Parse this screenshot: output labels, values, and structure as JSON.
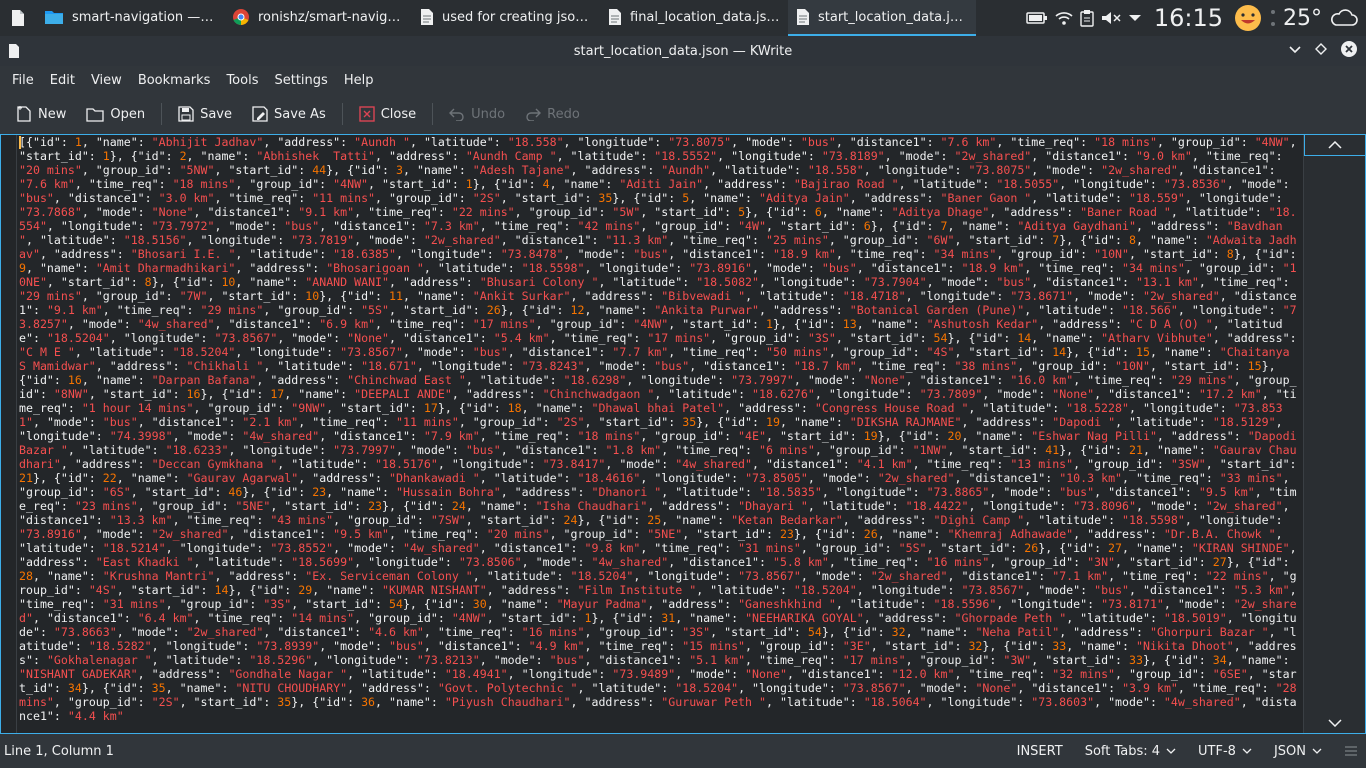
{
  "taskbar": {
    "tasks": [
      {
        "label": "smart-navigation — Do...",
        "icon": "folder-icon",
        "active": false
      },
      {
        "label": "ronishz/smart-navigati...",
        "icon": "chrome-icon",
        "active": false
      },
      {
        "label": "used for creating json ...",
        "icon": "document-icon",
        "active": false
      },
      {
        "label": "final_location_data.jso...",
        "icon": "document-icon",
        "active": false
      },
      {
        "label": "start_location_data.jso...",
        "icon": "document-icon",
        "active": true
      }
    ],
    "clock": "16:15",
    "temperature": "25°"
  },
  "window": {
    "title": "start_location_data.json — KWrite"
  },
  "menu": [
    "File",
    "Edit",
    "View",
    "Bookmarks",
    "Tools",
    "Settings",
    "Help"
  ],
  "toolbar": {
    "new": "New",
    "open": "Open",
    "save": "Save",
    "save_as": "Save As",
    "close": "Close",
    "undo": "Undo",
    "redo": "Redo"
  },
  "editor": {
    "content": "[{\"id\": 1, \"name\": \"Abhijit Jadhav\", \"address\": \"Aundh \", \"latitude\": \"18.558\", \"longitude\": \"73.8075\", \"mode\": \"bus\", \"distance1\": \"7.6 km\", \"time_req\": \"18 mins\", \"group_id\": \"4NW\", \"start_id\": 1}, {\"id\": 2, \"name\": \"Abhishek  Tatti\", \"address\": \"Aundh Camp \", \"latitude\": \"18.5552\", \"longitude\": \"73.8189\", \"mode\": \"2w_shared\", \"distance1\": \"9.0 km\", \"time_req\": \"20 mins\", \"group_id\": \"5NW\", \"start_id\": 44}, {\"id\": 3, \"name\": \"Adesh Tajane\", \"address\": \"Aundh\", \"latitude\": \"18.558\", \"longitude\": \"73.8075\", \"mode\": \"2w_shared\", \"distance1\": \"7.6 km\", \"time_req\": \"18 mins\", \"group_id\": \"4NW\", \"start_id\": 1}, {\"id\": 4, \"name\": \"Aditi Jain\", \"address\": \"Bajirao Road \", \"latitude\": \"18.5055\", \"longitude\": \"73.8536\", \"mode\": \"bus\", \"distance1\": \"3.0 km\", \"time_req\": \"11 mins\", \"group_id\": \"2S\", \"start_id\": 35}, {\"id\": 5, \"name\": \"Aditya Jain\", \"address\": \"Baner Gaon \", \"latitude\": \"18.559\", \"longitude\": \"73.7868\", \"mode\": \"None\", \"distance1\": \"9.1 km\", \"time_req\": \"22 mins\", \"group_id\": \"5W\", \"start_id\": 5}, {\"id\": 6, \"name\": \"Aditya Dhage\", \"address\": \"Baner Road \", \"latitude\": \"18.554\", \"longitude\": \"73.7972\", \"mode\": \"bus\", \"distance1\": \"7.3 km\", \"time_req\": \"42 mins\", \"group_id\": \"4W\", \"start_id\": 6}, {\"id\": 7, \"name\": \"Aditya Gaydhani\", \"address\": \"Bavdhan \", \"latitude\": \"18.5156\", \"longitude\": \"73.7819\", \"mode\": \"2w_shared\", \"distance1\": \"11.3 km\", \"time_req\": \"25 mins\", \"group_id\": \"6W\", \"start_id\": 7}, {\"id\": 8, \"name\": \"Adwaita Jadhav\", \"address\": \"Bhosari I.E. \", \"latitude\": \"18.6385\", \"longitude\": \"73.8478\", \"mode\": \"bus\", \"distance1\": \"18.9 km\", \"time_req\": \"34 mins\", \"group_id\": \"10N\", \"start_id\": 8}, {\"id\": 9, \"name\": \"Amit Dharmadhikari\", \"address\": \"Bhosarigoan \", \"latitude\": \"18.5598\", \"longitude\": \"73.8916\", \"mode\": \"bus\", \"distance1\": \"18.9 km\", \"time_req\": \"34 mins\", \"group_id\": \"10NE\", \"start_id\": 8}, {\"id\": 10, \"name\": \"ANAND WANI\", \"address\": \"Bhusari Colony \", \"latitude\": \"18.5082\", \"longitude\": \"73.7904\", \"mode\": \"bus\", \"distance1\": \"13.1 km\", \"time_req\": \"29 mins\", \"group_id\": \"7W\", \"start_id\": 10}, {\"id\": 11, \"name\": \"Ankit Surkar\", \"address\": \"Bibvewadi \", \"latitude\": \"18.4718\", \"longitude\": \"73.8671\", \"mode\": \"2w_shared\", \"distance1\": \"9.1 km\", \"time_req\": \"29 mins\", \"group_id\": \"5S\", \"start_id\": 26}, {\"id\": 12, \"name\": \"Ankita Purwar\", \"address\": \"Botanical Garden (Pune)\", \"latitude\": \"18.566\", \"longitude\": \"73.8257\", \"mode\": \"4w_shared\", \"distance1\": \"6.9 km\", \"time_req\": \"17 mins\", \"group_id\": \"4NW\", \"start_id\": 1}, {\"id\": 13, \"name\": \"Ashutosh Kedar\", \"address\": \"C D A (O) \", \"latitude\": \"18.5204\", \"longitude\": \"73.8567\", \"mode\": \"None\", \"distance1\": \"5.4 km\", \"time_req\": \"17 mins\", \"group_id\": \"3S\", \"start_id\": 54}, {\"id\": 14, \"name\": \"Atharv Vibhute\", \"address\": \"C M E \", \"latitude\": \"18.5204\", \"longitude\": \"73.8567\", \"mode\": \"bus\", \"distance1\": \"7.7 km\", \"time_req\": \"50 mins\", \"group_id\": \"4S\", \"start_id\": 14}, {\"id\": 15, \"name\": \"Chaitanya S Mamidwar\", \"address\": \"Chikhali \", \"latitude\": \"18.671\", \"longitude\": \"73.8243\", \"mode\": \"bus\", \"distance1\": \"18.7 km\", \"time_req\": \"38 mins\", \"group_id\": \"10N\", \"start_id\": 15}, {\"id\": 16, \"name\": \"Darpan Bafana\", \"address\": \"Chinchwad East \", \"latitude\": \"18.6298\", \"longitude\": \"73.7997\", \"mode\": \"None\", \"distance1\": \"16.0 km\", \"time_req\": \"29 mins\", \"group_id\": \"8NW\", \"start_id\": 16}, {\"id\": 17, \"name\": \"DEEPALI ANDE\", \"address\": \"Chinchwadgaon \", \"latitude\": \"18.6276\", \"longitude\": \"73.7809\", \"mode\": \"None\", \"distance1\": \"17.2 km\", \"time_req\": \"1 hour 14 mins\", \"group_id\": \"9NW\", \"start_id\": 17}, {\"id\": 18, \"name\": \"Dhawal bhai Patel\", \"address\": \"Congress House Road \", \"latitude\": \"18.5228\", \"longitude\": \"73.8531\", \"mode\": \"bus\", \"distance1\": \"2.1 km\", \"time_req\": \"11 mins\", \"group_id\": \"2S\", \"start_id\": 35}, {\"id\": 19, \"name\": \"DIKSHA RAJMANE\", \"address\": \"Dapodi \", \"latitude\": \"18.5129\", \"longitude\": \"74.3998\", \"mode\": \"4w_shared\", \"distance1\": \"7.9 km\", \"time_req\": \"18 mins\", \"group_id\": \"4E\", \"start_id\": 19}, {\"id\": 20, \"name\": \"Eshwar Nag Pilli\", \"address\": \"Dapodi Bazar \", \"latitude\": \"18.6233\", \"longitude\": \"73.7997\", \"mode\": \"bus\", \"distance1\": \"1.8 km\", \"time_req\": \"6 mins\", \"group_id\": \"1NW\", \"start_id\": 41}, {\"id\": 21, \"name\": \"Gaurav Chaudhari\", \"address\": \"Deccan Gymkhana \", \"latitude\": \"18.5176\", \"longitude\": \"73.8417\", \"mode\": \"4w_shared\", \"distance1\": \"4.1 km\", \"time_req\": \"13 mins\", \"group_id\": \"3SW\", \"start_id\": 21}, {\"id\": 22, \"name\": \"Gaurav Agarwal\", \"address\": \"Dhankawadi \", \"latitude\": \"18.4616\", \"longitude\": \"73.8505\", \"mode\": \"2w_shared\", \"distance1\": \"10.3 km\", \"time_req\": \"33 mins\", \"group_id\": \"6S\", \"start_id\": 46}, {\"id\": 23, \"name\": \"Hussain Bohra\", \"address\": \"Dhanori \", \"latitude\": \"18.5835\", \"longitude\": \"73.8865\", \"mode\": \"bus\", \"distance1\": \"9.5 km\", \"time_req\": \"23 mins\", \"group_id\": \"5NE\", \"start_id\": 23}, {\"id\": 24, \"name\": \"Isha Chaudhari\", \"address\": \"Dhayari \", \"latitude\": \"18.4422\", \"longitude\": \"73.8096\", \"mode\": \"2w_shared\", \"distance1\": \"13.3 km\", \"time_req\": \"43 mins\", \"group_id\": \"7SW\", \"start_id\": 24}, {\"id\": 25, \"name\": \"Ketan Bedarkar\", \"address\": \"Dighi Camp \", \"latitude\": \"18.5598\", \"longitude\": \"73.8916\", \"mode\": \"2w_shared\", \"distance1\": \"9.5 km\", \"time_req\": \"20 mins\", \"group_id\": \"5NE\", \"start_id\": 23}, {\"id\": 26, \"name\": \"Khemraj Adhawade\", \"address\": \"Dr.B.A. Chowk \", \"latitude\": \"18.5214\", \"longitude\": \"73.8552\", \"mode\": \"4w_shared\", \"distance1\": \"9.8 km\", \"time_req\": \"31 mins\", \"group_id\": \"5S\", \"start_id\": 26}, {\"id\": 27, \"name\": \"KIRAN SHINDE\", \"address\": \"East Khadki \", \"latitude\": \"18.5699\", \"longitude\": \"73.8506\", \"mode\": \"4w_shared\", \"distance1\": \"5.8 km\", \"time_req\": \"16 mins\", \"group_id\": \"3N\", \"start_id\": 27}, {\"id\": 28, \"name\": \"Krushna Mantri\", \"address\": \"Ex. Serviceman Colony \", \"latitude\": \"18.5204\", \"longitude\": \"73.8567\", \"mode\": \"2w_shared\", \"distance1\": \"7.1 km\", \"time_req\": \"22 mins\", \"group_id\": \"4S\", \"start_id\": 14}, {\"id\": 29, \"name\": \"KUMAR NISHANT\", \"address\": \"Film Institute \", \"latitude\": \"18.5204\", \"longitude\": \"73.8567\", \"mode\": \"bus\", \"distance1\": \"5.3 km\", \"time_req\": \"31 mins\", \"group_id\": \"3S\", \"start_id\": 54}, {\"id\": 30, \"name\": \"Mayur Padma\", \"address\": \"Ganeshkhind \", \"latitude\": \"18.5596\", \"longitude\": \"73.8171\", \"mode\": \"2w_shared\", \"distance1\": \"6.4 km\", \"time_req\": \"14 mins\", \"group_id\": \"4NW\", \"start_id\": 1}, {\"id\": 31, \"name\": \"NEEHARIKA GOYAL\", \"address\": \"Ghorpade Peth \", \"latitude\": \"18.5019\", \"longitude\": \"73.8663\", \"mode\": \"2w_shared\", \"distance1\": \"4.6 km\", \"time_req\": \"16 mins\", \"group_id\": \"3S\", \"start_id\": 54}, {\"id\": 32, \"name\": \"Neha Patil\", \"address\": \"Ghorpuri Bazar \", \"latitude\": \"18.5282\", \"longitude\": \"73.8939\", \"mode\": \"bus\", \"distance1\": \"4.9 km\", \"time_req\": \"15 mins\", \"group_id\": \"3E\", \"start_id\": 32}, {\"id\": 33, \"name\": \"Nikita Dhoot\", \"address\": \"Gokhalenagar \", \"latitude\": \"18.5296\", \"longitude\": \"73.8213\", \"mode\": \"bus\", \"distance1\": \"5.1 km\", \"time_req\": \"17 mins\", \"group_id\": \"3W\", \"start_id\": 33}, {\"id\": 34, \"name\": \"NISHANT GADEKAR\", \"address\": \"Gondhale Nagar \", \"latitude\": \"18.4941\", \"longitude\": \"73.9489\", \"mode\": \"None\", \"distance1\": \"12.0 km\", \"time_req\": \"32 mins\", \"group_id\": \"6SE\", \"start_id\": 34}, {\"id\": 35, \"name\": \"NITU CHOUDHARY\", \"address\": \"Govt. Polytechnic \", \"latitude\": \"18.5204\", \"longitude\": \"73.8567\", \"mode\": \"None\", \"distance1\": \"3.9 km\", \"time_req\": \"28 mins\", \"group_id\": \"2S\", \"start_id\": 35}, {\"id\": 36, \"name\": \"Piyush Chaudhari\", \"address\": \"Guruwar Peth \", \"latitude\": \"18.5064\", \"longitude\": \"73.8603\", \"mode\": \"4w_shared\", \"distance1\": \"4.4 km\""
  },
  "statusbar": {
    "position": "Line 1, Column 1",
    "mode": "INSERT",
    "tabs": "Soft Tabs: 4",
    "encoding": "UTF-8",
    "syntax": "JSON"
  },
  "colors": {
    "accent": "#3daee9",
    "string": "#f44f4f",
    "number": "#f67400"
  }
}
